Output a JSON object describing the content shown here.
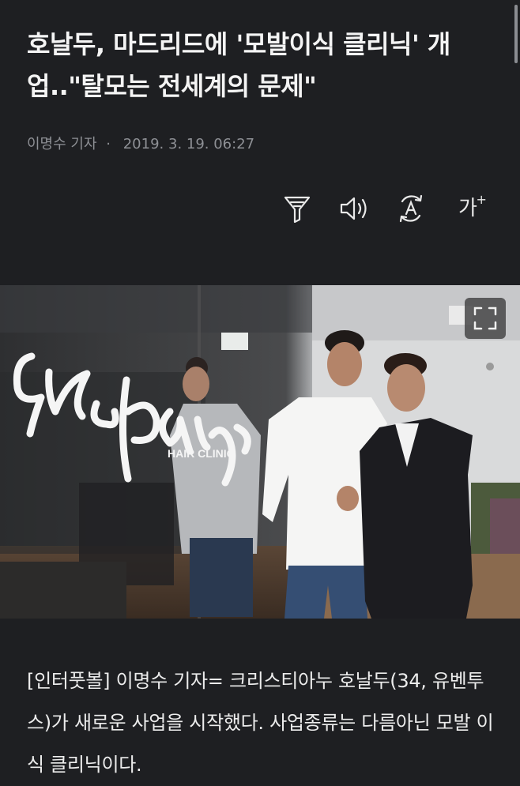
{
  "article": {
    "headline": "호날두, 마드리드에 '모발이식 클리닉' 개업..\"탈모는 전세계의 문제\"",
    "reporter": "이명수 기자",
    "separator": "·",
    "timestamp": "2019. 3. 19. 06:27",
    "body": "[인터풋볼] 이명수 기자= 크리스티아누 호날두(34, 유벤투스)가 새로운 사업을 시작했다. 사업종류는 다름아닌 모발 이식 클리닉이다."
  },
  "toolbar": {
    "icons": [
      "filter-icon",
      "speaker-icon",
      "translate-icon",
      "font-size-icon"
    ],
    "font_size_label": "가",
    "font_size_plus": "+"
  },
  "photo": {
    "sign_script": "insparya",
    "sign_sub": "HAIR CLINIC",
    "expand_icon": "fullscreen-icon"
  },
  "colors": {
    "background": "#1e1f22",
    "headline": "#f4f4f4",
    "byline": "#8e9095",
    "body": "#ececec"
  }
}
